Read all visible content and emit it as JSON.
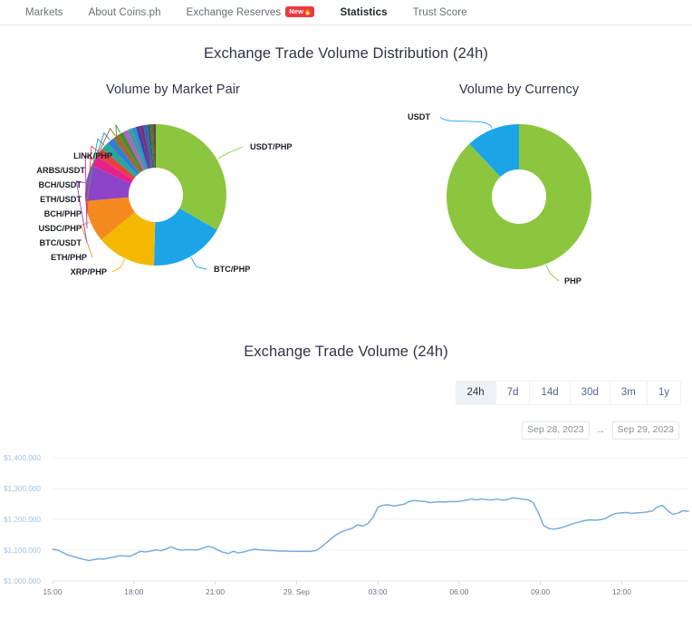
{
  "nav": {
    "items": [
      {
        "label": "Markets",
        "active": false,
        "badge": null
      },
      {
        "label": "About Coins.ph",
        "active": false,
        "badge": null
      },
      {
        "label": "Exchange Reserves",
        "active": false,
        "badge": "New🔥"
      },
      {
        "label": "Statistics",
        "active": true,
        "badge": null
      },
      {
        "label": "Trust Score",
        "active": false,
        "badge": null
      }
    ]
  },
  "distribution": {
    "title": "Exchange Trade Volume Distribution (24h)",
    "left_title": "Volume by Market Pair",
    "right_title": "Volume by Currency"
  },
  "volume_section": {
    "title": "Exchange Trade Volume (24h)",
    "ranges": [
      {
        "label": "24h",
        "active": true
      },
      {
        "label": "7d",
        "active": false
      },
      {
        "label": "14d",
        "active": false
      },
      {
        "label": "30d",
        "active": false
      },
      {
        "label": "3m",
        "active": false
      },
      {
        "label": "1y",
        "active": false
      }
    ],
    "date_from": "Sep 28, 2023",
    "date_to": "Sep 29, 2023",
    "date_separator": "→"
  },
  "chart_data": [
    {
      "type": "pie",
      "title": "Volume by Market Pair",
      "labels": [
        "USDT/PHP",
        "BTC/PHP",
        "XRP/PHP",
        "ETH/PHP",
        "BTC/USDT",
        "USDC/PHP",
        "BCH/PHP",
        "ETH/USDT",
        "BCH/USDT",
        "ARBS/USDT",
        "LINK/PHP"
      ],
      "values": [
        33.0,
        17.0,
        13.5,
        9.5,
        8.2,
        2.4,
        2.0,
        1.8,
        1.6,
        1.4,
        1.2
      ],
      "other_values": [
        1.1,
        1.0,
        0.95,
        0.9,
        0.85,
        0.8,
        0.75,
        0.7,
        0.55
      ],
      "colors": [
        "#8cc63f",
        "#1ba5e8",
        "#f5b800",
        "#f58a1f",
        "#8e44c8",
        "#e8218a",
        "#e84040",
        "#2aa79b",
        "#2f7de0",
        "#9e6b2f",
        "#4a8c2f"
      ],
      "other_colors": [
        "#b05fd0",
        "#3f9e8c",
        "#2b8fd6",
        "#4a3fa0",
        "#7a2f7a",
        "#3a5fc0",
        "#1f6f5f",
        "#7a5f2f",
        "#4b4b4b"
      ],
      "donut": true,
      "legend": "callout-labels"
    },
    {
      "type": "pie",
      "title": "Volume by Currency",
      "labels": [
        "PHP",
        "USDT"
      ],
      "values": [
        88.0,
        12.0
      ],
      "colors": [
        "#8cc63f",
        "#1ba5e8"
      ],
      "donut": true,
      "legend": "callout-labels"
    },
    {
      "type": "line",
      "title": "Exchange Trade Volume (24h)",
      "xlabel": "",
      "ylabel": "",
      "ylim": [
        1000000,
        1400000
      ],
      "ytick_labels": [
        "$1,000,000",
        "$1,100,000",
        "$1,200,000",
        "$1,300,000",
        "$1,400,000"
      ],
      "ytick_values": [
        1000000,
        1100000,
        1200000,
        1300000,
        1400000
      ],
      "xtick_labels": [
        "15:00",
        "18:00",
        "21:00",
        "29. Sep",
        "03:00",
        "06:00",
        "09:00",
        "12:00"
      ],
      "grid": true,
      "series_color": "#7cacd8",
      "values": [
        1103000,
        1100000,
        1092000,
        1084000,
        1079000,
        1074000,
        1070000,
        1066000,
        1069000,
        1072000,
        1071000,
        1075000,
        1078000,
        1082000,
        1081000,
        1080000,
        1088000,
        1096000,
        1094000,
        1097000,
        1101000,
        1098000,
        1104000,
        1110000,
        1103000,
        1100000,
        1102000,
        1101000,
        1100000,
        1106000,
        1112000,
        1109000,
        1100000,
        1093000,
        1089000,
        1096000,
        1091000,
        1094000,
        1099000,
        1103000,
        1101000,
        1100000,
        1099000,
        1098000,
        1097000,
        1097000,
        1096000,
        1096000,
        1096000,
        1096000,
        1096000,
        1099000,
        1110000,
        1124000,
        1139000,
        1151000,
        1160000,
        1166000,
        1171000,
        1182000,
        1178000,
        1186000,
        1207000,
        1240000,
        1246000,
        1247000,
        1243000,
        1246000,
        1249000,
        1258000,
        1261000,
        1259000,
        1258000,
        1254000,
        1256000,
        1257000,
        1256000,
        1258000,
        1257000,
        1259000,
        1262000,
        1266000,
        1263000,
        1266000,
        1264000,
        1263000,
        1266000,
        1262000,
        1264000,
        1270000,
        1268000,
        1265000,
        1263000,
        1254000,
        1220000,
        1180000,
        1170000,
        1168000,
        1171000,
        1176000,
        1182000,
        1187000,
        1192000,
        1196000,
        1198000,
        1197000,
        1199000,
        1203000,
        1213000,
        1219000,
        1221000,
        1222000,
        1219000,
        1221000,
        1222000,
        1224000,
        1227000,
        1240000,
        1245000,
        1228000,
        1216000,
        1220000,
        1228000,
        1226000
      ]
    }
  ]
}
